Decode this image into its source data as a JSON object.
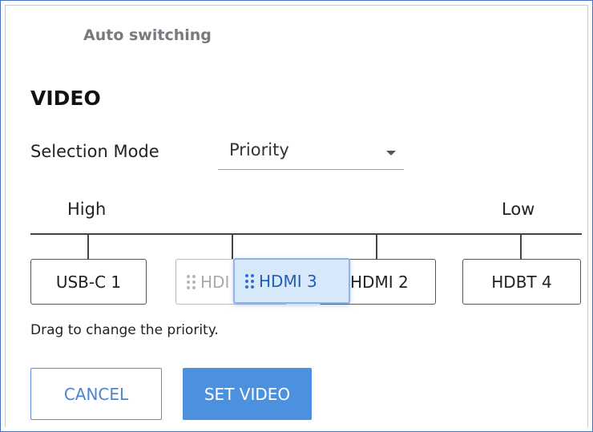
{
  "section": {
    "title": "Auto switching"
  },
  "video": {
    "heading": "VIDEO",
    "selection_mode_label": "Selection Mode",
    "selection_mode_value": "Priority"
  },
  "priority": {
    "high_label": "High",
    "low_label": "Low",
    "ports": {
      "usbc1": "USB-C 1",
      "ghost": "HDI",
      "dragging": "HDMI 3",
      "hdmi2": "HDMI 2",
      "hdbt4": "HDBT 4"
    },
    "hint": "Drag to change the priority."
  },
  "buttons": {
    "cancel": "CANCEL",
    "set_video": "SET VIDEO"
  },
  "colors": {
    "accent": "#4c91e0",
    "drag_highlight": "#d8e8fb",
    "frame": "#4a72c4"
  },
  "icons": {
    "drag_handle": "grip-dots-icon",
    "dropdown": "caret-down-icon"
  }
}
